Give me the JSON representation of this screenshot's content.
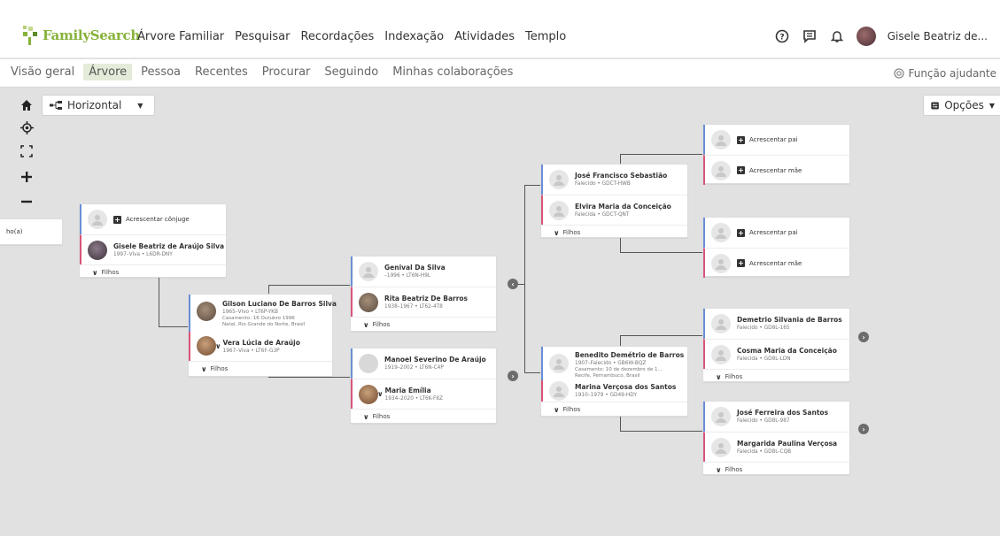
{
  "header": {
    "logo_text": "FamilySearch",
    "nav": [
      "Árvore Familiar",
      "Pesquisar",
      "Recordações",
      "Indexação",
      "Atividades",
      "Templo"
    ],
    "user_name": "Gisele Beatriz de..."
  },
  "subnav": {
    "tabs": [
      "Visão geral",
      "Árvore",
      "Pessoa",
      "Recentes",
      "Procurar",
      "Seguindo",
      "Minhas colaborações"
    ],
    "active_tab": "Árvore",
    "helper_label": "Função ajudante"
  },
  "toolbar": {
    "view_label": "Horizontal",
    "options_label": "Opções"
  },
  "labels": {
    "add_father": "Acrescentar pai",
    "add_mother": "Acrescentar mãe",
    "add_spouse": "Acrescentar cônjuge",
    "children": "Filhos",
    "left_partial": "ho(a)"
  },
  "people": {
    "gisele": {
      "name": "Gisele Beatriz de Araújo Silva",
      "info": "1997–Viva • L6DR-DNY"
    },
    "gilson": {
      "name": "Gilson Luciano De Barros Silva",
      "info": "1965–Vivo • LT6P-YKB",
      "marriage1": "Casamento: 16 Outubro 1996",
      "marriage2": "Natal, Rio Grande do Norte, Brasil"
    },
    "vera": {
      "name": "Vera Lúcia de Araújo",
      "info": "1967–Viva • LT6F-G3P"
    },
    "genival": {
      "name": "Genival Da Silva",
      "info": "–1996 • LT6N-H9L"
    },
    "rita": {
      "name": "Rita Beatriz De Barros",
      "info": "1938–1967 • LT62-4T8"
    },
    "manoel": {
      "name": "Manoel Severino De Araújo",
      "info": "1919–2002 • LT6N-C4P"
    },
    "maria": {
      "name": "Maria Emília",
      "info": "1934–2020 • LT6K-F8Z"
    },
    "jose_f": {
      "name": "José Francisco Sebastião",
      "info": "Falecido • GDCT-HWB"
    },
    "elvira": {
      "name": "Elvira Maria da Conceição",
      "info": "Falecida • GDCT-QNT"
    },
    "benedito": {
      "name": "Benedito Demétrio de Barros",
      "info": "1907–Falecido • GB6W-BQZ",
      "marriage1": "Casamento: 10 de dezembro de 1...",
      "marriage2": "Recife, Pernambuco, Brasil"
    },
    "marina": {
      "name": "Marina Verçosa dos Santos",
      "info": "1910–1979 • GD49-HDY"
    },
    "demetrio": {
      "name": "Demetrio Silvania de Barros",
      "info": "Falecido • GD8L-165"
    },
    "cosma": {
      "name": "Cosma Maria da Conceição",
      "info": "Falecida • GD8L-LDN"
    },
    "jose_fs": {
      "name": "José Ferreira dos Santos",
      "info": "Falecido • GD8L-987"
    },
    "margarida": {
      "name": "Margarida Paulina Verçosa",
      "info": "Falecida • GD8L-CQB"
    }
  }
}
